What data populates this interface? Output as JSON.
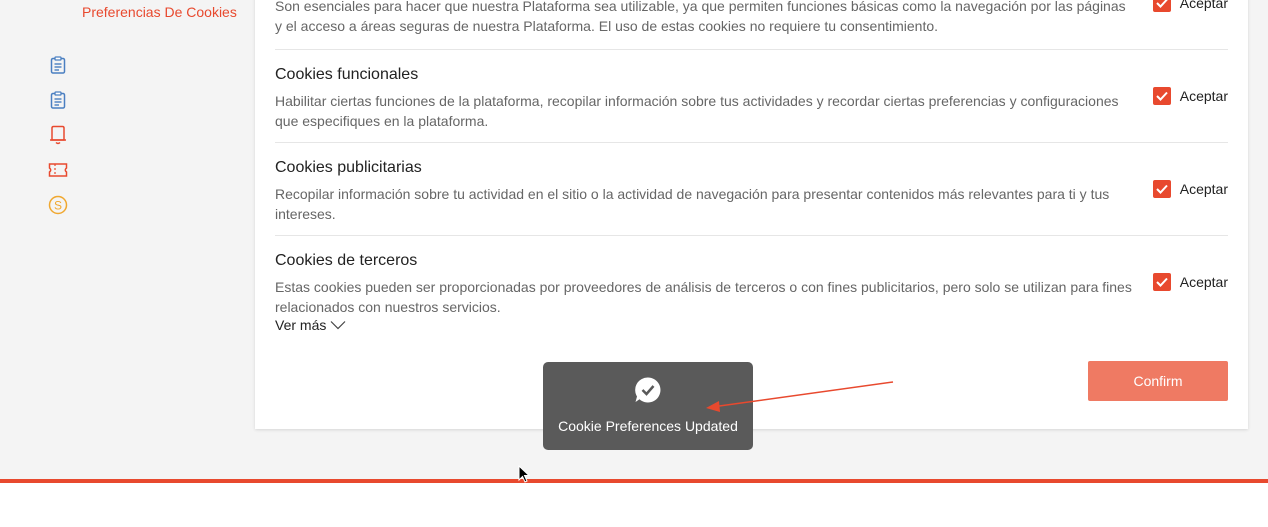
{
  "sidebar": {
    "active_item": "Preferencias De Cookies",
    "icons": [
      "clipboard-icon",
      "clipboard-icon",
      "bell-icon",
      "ticket-icon",
      "coin-icon"
    ]
  },
  "cookies": {
    "essential": {
      "description": "Son esenciales para hacer que nuestra Plataforma sea utilizable, ya que permiten funciones básicas como la navegación por las páginas y el acceso a áreas seguras de nuestra Plataforma. El uso de estas cookies no requiere tu consentimiento.",
      "accept_label": "Aceptar",
      "checked": true
    },
    "functional": {
      "title": "Cookies funcionales",
      "description": "Habilitar ciertas funciones de la plataforma, recopilar información sobre tus actividades y recordar ciertas preferencias y configuraciones que especifiques en la plataforma.",
      "accept_label": "Aceptar",
      "checked": true
    },
    "advertising": {
      "title": "Cookies publicitarias",
      "description": "Recopilar información sobre tu actividad en el sitio o la actividad de navegación para presentar contenidos más relevantes para ti y tus intereses.",
      "accept_label": "Aceptar",
      "checked": true
    },
    "third_party": {
      "title": "Cookies de terceros",
      "description": "Estas cookies pueden ser proporcionadas por proveedores de análisis de terceros o con fines publicitarios, pero solo se utilizan para fines relacionados con nuestros servicios.",
      "accept_label": "Aceptar",
      "checked": true
    }
  },
  "ver_mas": "Ver más",
  "confirm_label": "Confirm",
  "toast": {
    "message": "Cookie Preferences Updated"
  },
  "colors": {
    "accent": "#e8492e",
    "confirm_bg": "#ef7a63",
    "toast_bg": "#5a5a5a",
    "icon_blue": "#4a7fc1",
    "icon_orange": "#f0a830"
  }
}
